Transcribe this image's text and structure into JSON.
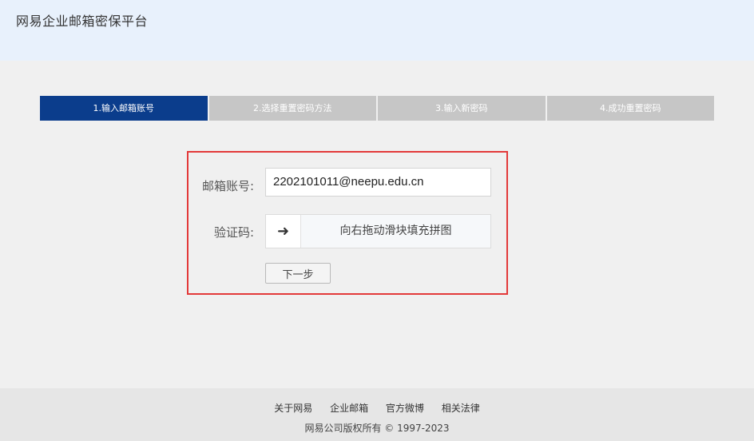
{
  "header": {
    "title": "网易企业邮箱密保平台"
  },
  "steps": [
    {
      "label": "1.输入邮箱账号",
      "active": true
    },
    {
      "label": "2.选择重置密码方法",
      "active": false
    },
    {
      "label": "3.输入新密码",
      "active": false
    },
    {
      "label": "4.成功重置密码",
      "active": false
    }
  ],
  "form": {
    "email_label": "邮箱账号:",
    "email_value": "2202101011@neepu.edu.cn",
    "captcha_label": "验证码:",
    "slider_arrow": "➜",
    "slider_text": "向右拖动滑块填充拼图",
    "next_label": "下一步"
  },
  "footer": {
    "links": [
      "关于网易",
      "企业邮箱",
      "官方微博",
      "相关法律"
    ],
    "copyright": "网易公司版权所有 © 1997-2023"
  },
  "colors": {
    "active_step": "#0b3d8c",
    "inactive_step": "#c6c6c6",
    "highlight_border": "#e33a3a",
    "header_bg": "#e8f1fc"
  }
}
